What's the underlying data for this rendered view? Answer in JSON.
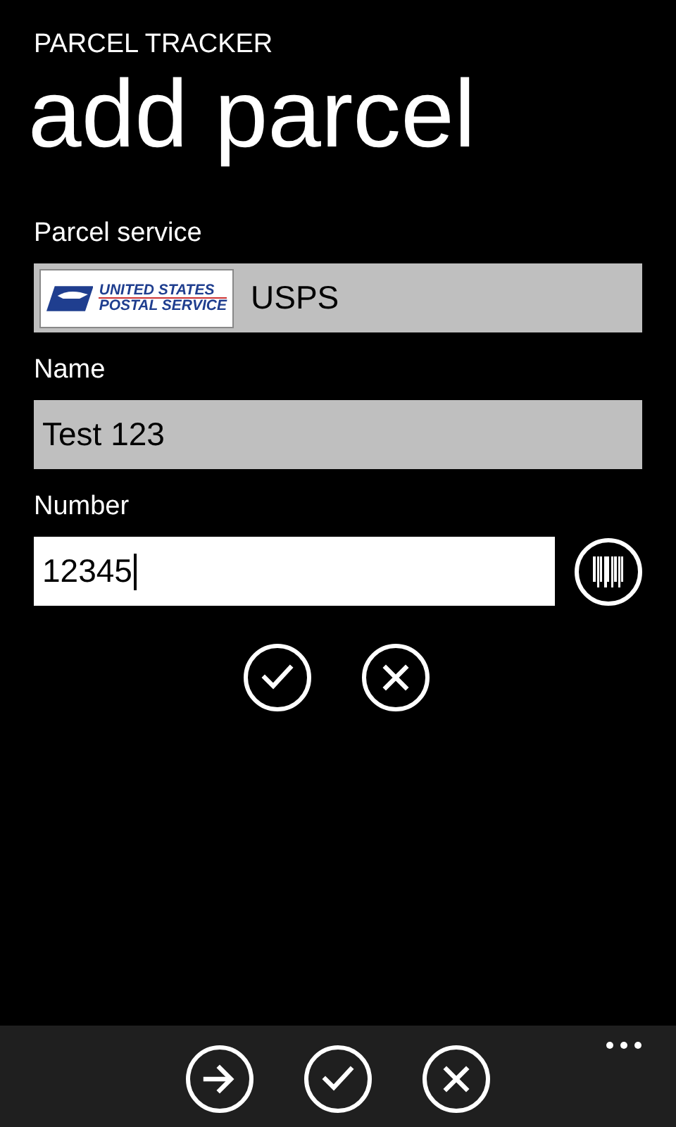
{
  "app_title": "PARCEL TRACKER",
  "page_title": "add parcel",
  "fields": [
    {
      "kind": "picker",
      "label": "Parcel service",
      "value": "USPS",
      "logo": {
        "line_1": "UNITED STATES",
        "line_2": "POSTAL SERVICE"
      },
      "focused": false
    },
    {
      "kind": "text",
      "label": "Name",
      "value": "Test 123",
      "focused": false
    },
    {
      "kind": "scan",
      "label": "Number",
      "value": "12345",
      "focused": true
    }
  ],
  "form_buttons": [
    {
      "kind": "confirm"
    },
    {
      "kind": "cancel"
    }
  ],
  "app_bar": {
    "buttons": [
      {
        "kind": "next"
      },
      {
        "kind": "confirm"
      },
      {
        "kind": "cancel"
      }
    ]
  }
}
